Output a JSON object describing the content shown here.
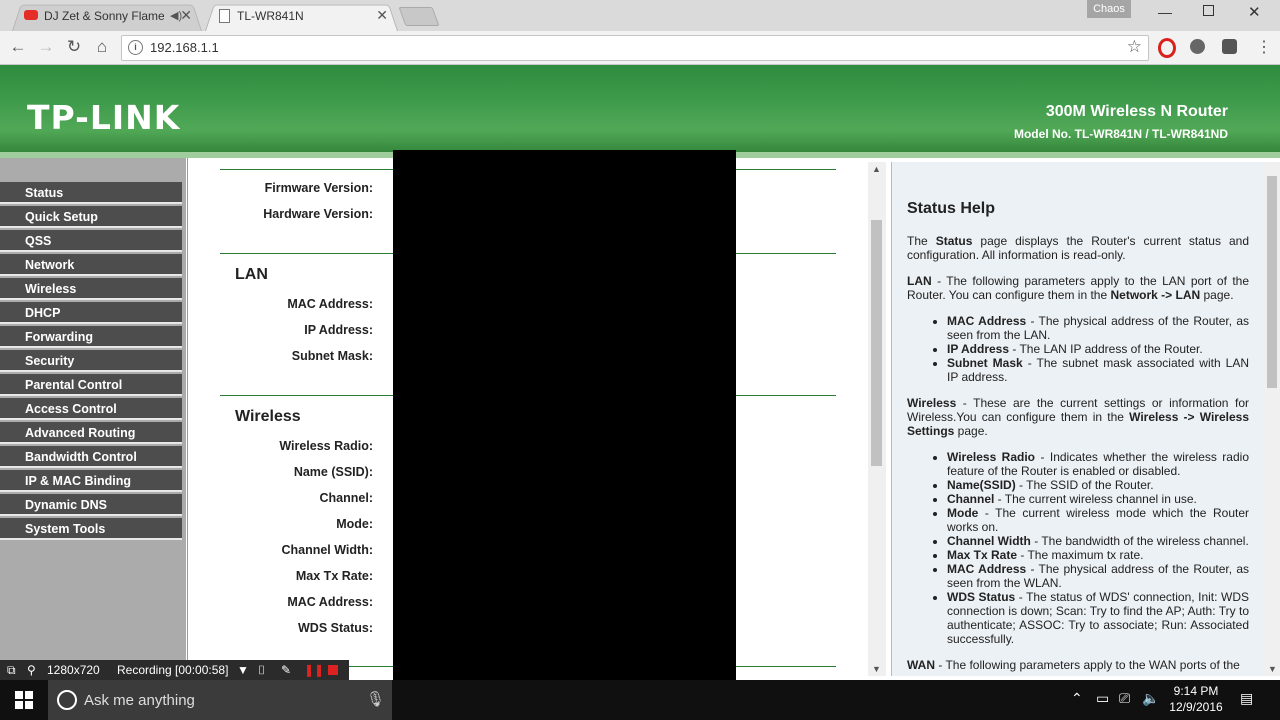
{
  "browser": {
    "tabs": [
      {
        "title": "DJ Zet & Sonny Flame"
      },
      {
        "title": "TL-WR841N"
      }
    ],
    "profile": "Chaos",
    "url": "192.168.1.1"
  },
  "banner": {
    "logo": "TP-LINK",
    "product": "300M Wireless N Router",
    "model": "Model No. TL-WR841N / TL-WR841ND"
  },
  "sidebar": {
    "items": [
      "Status",
      "Quick Setup",
      "QSS",
      "Network",
      "Wireless",
      "DHCP",
      "Forwarding",
      "Security",
      "Parental Control",
      "Access Control",
      "Advanced Routing",
      "Bandwidth Control",
      "IP & MAC Binding",
      "Dynamic DNS",
      "System Tools"
    ]
  },
  "main": {
    "top_labels": [
      "Firmware Version:",
      "Hardware Version:"
    ],
    "lan_title": "LAN",
    "lan_labels": [
      "MAC Address:",
      "IP Address:",
      "Subnet Mask:"
    ],
    "wireless_title": "Wireless",
    "wireless_labels": [
      "Wireless Radio:",
      "Name (SSID):",
      "Channel:",
      "Mode:",
      "Channel Width:",
      "Max Tx Rate:",
      "MAC Address:",
      "WDS Status:"
    ]
  },
  "help": {
    "title": "Status Help",
    "intro_pre": "The ",
    "intro_bold": "Status",
    "intro_post": " page displays the Router's current status and configuration. All information is read-only.",
    "lan_bold": "LAN",
    "lan_text": " - The following parameters apply to the LAN port of the Router. You can configure them in the ",
    "lan_link": "Network -> LAN",
    "lan_end": " page.",
    "lan_items": [
      {
        "b": "MAC Address",
        "t": " - The physical address of the Router, as seen from the LAN."
      },
      {
        "b": "IP Address",
        "t": " - The LAN IP address of the Router."
      },
      {
        "b": "Subnet Mask",
        "t": " - The subnet mask associated with LAN IP address."
      }
    ],
    "wl_bold": "Wireless",
    "wl_text": " - These are the current settings or information for Wireless.You can configure them in the ",
    "wl_link": "Wireless -> Wireless Settings",
    "wl_end": " page.",
    "wl_items": [
      {
        "b": "Wireless Radio",
        "t": " - Indicates whether the wireless radio feature of the Router is enabled or disabled."
      },
      {
        "b": "Name(SSID)",
        "t": " - The SSID of the Router."
      },
      {
        "b": "Channel",
        "t": " - The current wireless channel in use."
      },
      {
        "b": "Mode",
        "t": " - The current wireless mode which the Router works on."
      },
      {
        "b": "Channel Width",
        "t": " - The bandwidth of the wireless channel."
      },
      {
        "b": "Max Tx Rate",
        "t": " - The maximum tx rate."
      },
      {
        "b": "MAC Address",
        "t": " - The physical address of the Router, as seen from the WLAN."
      },
      {
        "b": "WDS Status",
        "t": " - The status of WDS' connection, Init: WDS connection is down; Scan: Try to find the AP; Auth: Try to authenticate; ASSOC: Try to associate; Run: Associated successfully."
      }
    ],
    "wan_bold": "WAN",
    "wan_text": " - The following parameters apply to the WAN ports of the"
  },
  "recorder": {
    "resolution": "1280x720",
    "status": "Recording [00:00:58]"
  },
  "taskbar": {
    "search_placeholder": "Ask me anything",
    "time": "9:14 PM",
    "date": "12/9/2016"
  }
}
